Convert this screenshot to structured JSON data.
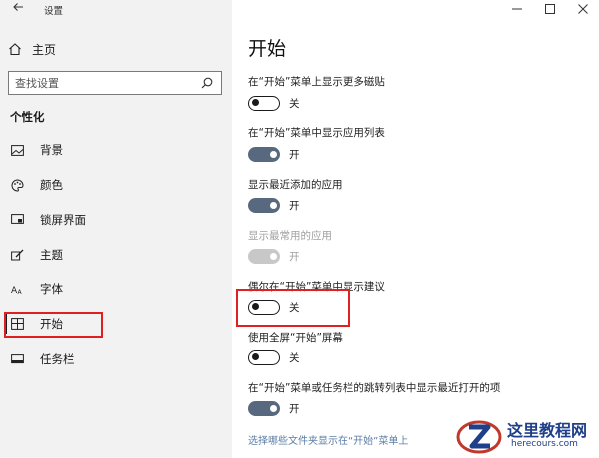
{
  "window": {
    "title": "设置",
    "controls": {
      "minimize": "—",
      "maximize": "☐",
      "close": "✕"
    }
  },
  "sidebar": {
    "home_label": "主页",
    "search_placeholder": "查找设置",
    "section_title": "个性化",
    "items": [
      {
        "label": "背景",
        "icon": "picture-icon"
      },
      {
        "label": "颜色",
        "icon": "palette-icon"
      },
      {
        "label": "锁屏界面",
        "icon": "lock-screen-icon"
      },
      {
        "label": "主题",
        "icon": "brush-icon"
      },
      {
        "label": "字体",
        "icon": "font-icon"
      },
      {
        "label": "开始",
        "icon": "start-icon",
        "selected": true
      },
      {
        "label": "任务栏",
        "icon": "taskbar-icon"
      }
    ]
  },
  "main": {
    "title": "开始",
    "settings": [
      {
        "label": "在“开始”菜单上显示更多磁贴",
        "state": "关",
        "on": false,
        "disabled": false
      },
      {
        "label": "在“开始”菜单中显示应用列表",
        "state": "开",
        "on": true,
        "disabled": false
      },
      {
        "label": "显示最近添加的应用",
        "state": "开",
        "on": true,
        "disabled": false
      },
      {
        "label": "显示最常用的应用",
        "state": "开",
        "on": true,
        "disabled": true
      },
      {
        "label": "偶尔在“开始”菜单中显示建议",
        "state": "关",
        "on": false,
        "disabled": false
      },
      {
        "label": "使用全屏“开始”屏幕",
        "state": "关",
        "on": false,
        "disabled": false
      },
      {
        "label": "在“开始”菜单或任务栏的跳转列表中显示最近打开的项",
        "state": "开",
        "on": true,
        "disabled": false
      }
    ],
    "link": "选择哪些文件夹显示在“开始”菜单上"
  },
  "watermark": {
    "title": "这里教程网",
    "url": "herecours.com"
  },
  "colors": {
    "sidebar_bg": "#f2f2f2",
    "toggle_on": "#58697f",
    "highlight": "#e02020",
    "link": "#5b7ea6"
  }
}
